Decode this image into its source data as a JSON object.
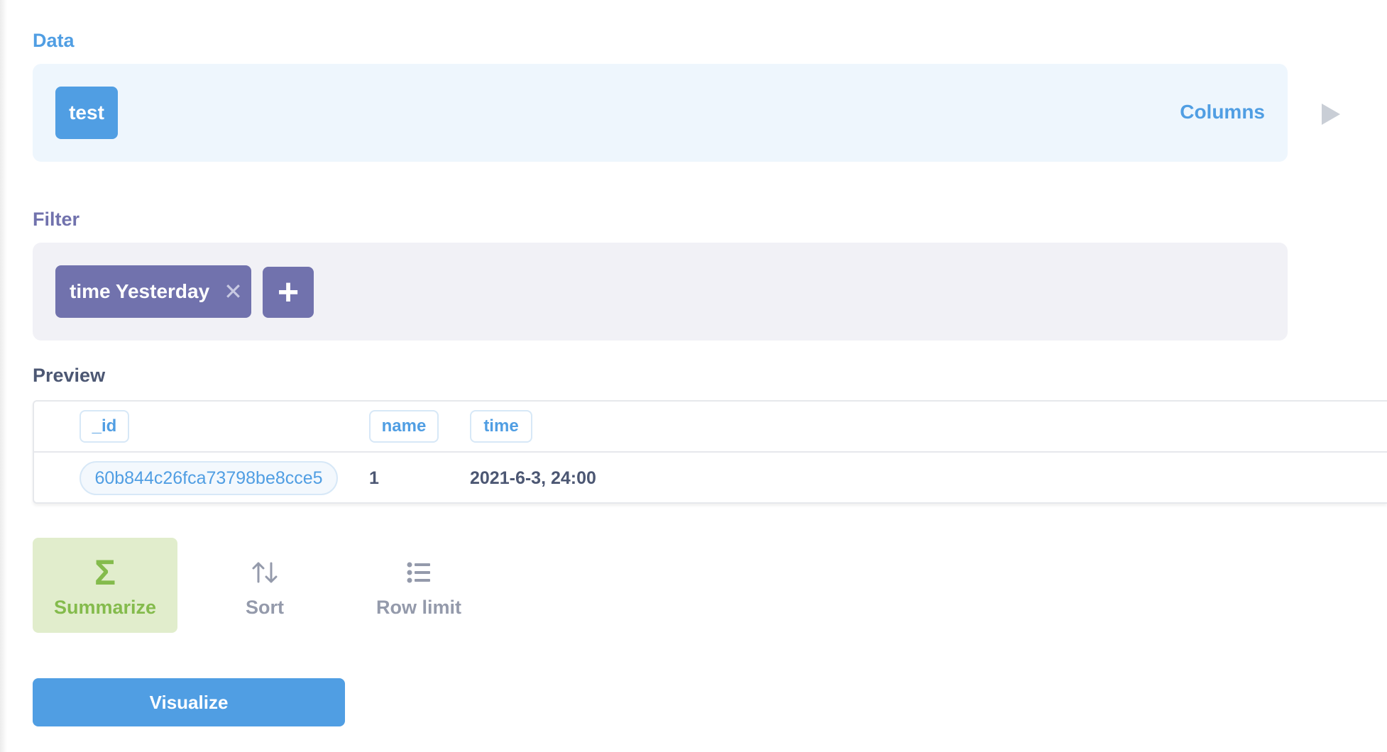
{
  "data_section": {
    "label": "Data",
    "table_name": "test",
    "columns_link": "Columns"
  },
  "filter_section": {
    "label": "Filter",
    "filters": [
      {
        "label": "time Yesterday",
        "remove_glyph": "✕"
      }
    ],
    "add_glyph": "+"
  },
  "preview": {
    "label": "Preview",
    "columns": [
      "_id",
      "name",
      "time"
    ],
    "rows": [
      [
        "60b844c26fca73798be8cce5",
        "1",
        "2021-6-3, 24:00"
      ]
    ]
  },
  "actions": [
    {
      "label": "Summarize",
      "icon": "sigma-icon",
      "glyph": "Σ"
    },
    {
      "label": "Sort",
      "icon": "sort-arrows-icon"
    },
    {
      "label": "Row limit",
      "icon": "list-icon"
    }
  ],
  "visualize_label": "Visualize",
  "colors": {
    "brand": "#509ee3",
    "filter": "#7172ad",
    "summarize": "#84bb4c",
    "muted": "#949aab"
  }
}
